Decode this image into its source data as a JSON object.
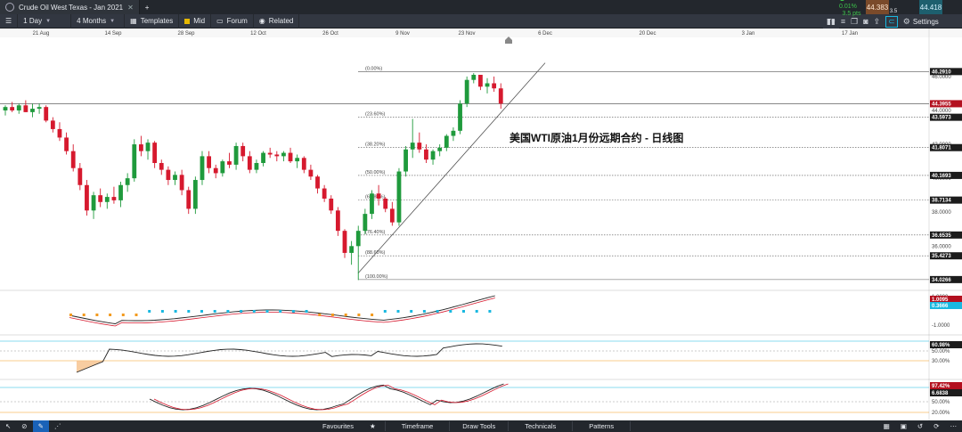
{
  "tab": {
    "title": "Crude Oil West Texas - Jan 2021",
    "close": "✕",
    "add": "+"
  },
  "toolbar": {
    "interval": "1 Day",
    "range": "4 Months",
    "templates": "Templates",
    "mid": "Mid",
    "forum": "Forum",
    "related": "Related",
    "change_pct": "▲ 0.01%",
    "change_pts": "3.5 pts",
    "bid": "44.383",
    "spread": "3.5",
    "ask": "44.418",
    "settings": "Settings"
  },
  "chart_title": "美国WTI原油1月份远期合约 - 日线图",
  "x_ticks": [
    "21 Aug",
    "14 Sep",
    "28 Sep",
    "12 Oct",
    "26 Oct",
    "9 Nov",
    "23 Nov",
    "6 Dec",
    "20 Dec",
    "3 Jan",
    "17 Jan"
  ],
  "price_ticks": [
    "46.0000",
    "44.0000",
    "42.0000",
    "40.0000",
    "38.0000",
    "36.0000",
    "34.0000"
  ],
  "price_tags": [
    {
      "label": "46.2910",
      "style": "dark",
      "v": 46.291
    },
    {
      "label": "44.3955",
      "style": "red",
      "v": 44.3955
    },
    {
      "label": "43.5973",
      "style": "dark",
      "v": 43.5973
    },
    {
      "label": "41.8071",
      "style": "dark",
      "v": 41.8071
    },
    {
      "label": "40.1693",
      "style": "dark",
      "v": 40.1693
    },
    {
      "label": "38.7134",
      "style": "dark",
      "v": 38.7134
    },
    {
      "label": "36.6535",
      "style": "dark",
      "v": 36.6535
    },
    {
      "label": "35.4273",
      "style": "dark",
      "v": 35.4273
    },
    {
      "label": "34.0266",
      "style": "dark",
      "v": 34.0266
    }
  ],
  "fib_levels": [
    {
      "label": "(0.00%)",
      "v": 46.291
    },
    {
      "label": "(23.60%)",
      "v": 43.5973
    },
    {
      "label": "(38.20%)",
      "v": 41.8071
    },
    {
      "label": "(50.00%)",
      "v": 40.1693
    },
    {
      "label": "(61.80%)",
      "v": 38.7134
    },
    {
      "label": "(76.40%)",
      "v": 36.6535
    },
    {
      "label": "(88.60%)",
      "v": 35.4273
    },
    {
      "label": "(100.00%)",
      "v": 34.0266
    }
  ],
  "macd_ticks": [
    "1.0000",
    "-1.0000"
  ],
  "macd_tags": [
    {
      "label": "1.0095",
      "style": "red"
    },
    {
      "label": "0.3666",
      "style": "cyan"
    }
  ],
  "rsi_ticks": [
    "50.00%",
    "30.00%"
  ],
  "rsi_tag": {
    "label": "60.98%",
    "style": "dark"
  },
  "stoch_ticks": [
    "50.00%",
    "20.00%"
  ],
  "stoch_tags": [
    {
      "label": "97.42%",
      "style": "red"
    },
    {
      "label": "6.6838",
      "style": "dark"
    }
  ],
  "footer": {
    "favourites": "Favourites",
    "timeframe": "Timeframe",
    "draw_tools": "Draw Tools",
    "technicals": "Technicals",
    "patterns": "Patterns"
  },
  "colors": {
    "up": "#1f9a3c",
    "down": "#d6192e",
    "accent": "#19b8e0",
    "fib": "#555555"
  },
  "chart_data": {
    "type": "candlestick",
    "ylim": [
      33.6,
      48.2
    ],
    "candles": [
      [
        44.0,
        44.3,
        43.7,
        44.2
      ],
      [
        44.2,
        44.5,
        43.9,
        44.0
      ],
      [
        44.0,
        44.4,
        43.8,
        44.3
      ],
      [
        44.3,
        44.6,
        43.9,
        43.9
      ],
      [
        43.9,
        44.4,
        43.6,
        44.1
      ],
      [
        44.1,
        44.4,
        43.8,
        44.2
      ],
      [
        44.2,
        44.3,
        43.3,
        43.4
      ],
      [
        43.4,
        43.6,
        42.7,
        42.9
      ],
      [
        42.9,
        43.3,
        42.2,
        42.4
      ],
      [
        42.4,
        42.7,
        41.4,
        41.6
      ],
      [
        41.6,
        42.0,
        40.4,
        40.6
      ],
      [
        40.6,
        40.9,
        39.3,
        39.6
      ],
      [
        39.6,
        39.9,
        37.8,
        38.1
      ],
      [
        38.1,
        39.2,
        37.6,
        39.0
      ],
      [
        39.0,
        39.4,
        38.3,
        38.6
      ],
      [
        38.6,
        39.1,
        38.2,
        38.9
      ],
      [
        38.9,
        39.5,
        38.5,
        38.7
      ],
      [
        38.7,
        39.8,
        38.3,
        39.6
      ],
      [
        39.6,
        40.3,
        39.2,
        40.0
      ],
      [
        40.0,
        42.3,
        39.8,
        42.0
      ],
      [
        42.0,
        42.5,
        41.3,
        41.6
      ],
      [
        41.6,
        42.3,
        41.1,
        42.1
      ],
      [
        42.1,
        42.2,
        40.6,
        40.9
      ],
      [
        40.9,
        41.1,
        40.2,
        40.5
      ],
      [
        40.5,
        40.7,
        39.6,
        39.9
      ],
      [
        39.9,
        40.4,
        39.6,
        40.2
      ],
      [
        40.2,
        40.5,
        39.0,
        39.3
      ],
      [
        39.3,
        39.5,
        37.9,
        38.2
      ],
      [
        38.2,
        40.1,
        37.9,
        39.9
      ],
      [
        39.9,
        41.6,
        39.6,
        41.3
      ],
      [
        41.3,
        41.6,
        40.3,
        40.6
      ],
      [
        40.6,
        40.8,
        40.0,
        40.3
      ],
      [
        40.3,
        41.1,
        40.1,
        41.0
      ],
      [
        41.0,
        41.5,
        40.6,
        40.8
      ],
      [
        40.8,
        42.1,
        40.5,
        41.9
      ],
      [
        41.9,
        42.1,
        41.0,
        41.3
      ],
      [
        41.3,
        41.6,
        40.3,
        40.5
      ],
      [
        40.5,
        41.1,
        40.3,
        40.9
      ],
      [
        40.9,
        41.6,
        40.7,
        41.5
      ],
      [
        41.5,
        41.8,
        41.2,
        41.4
      ],
      [
        41.4,
        41.6,
        41.0,
        41.3
      ],
      [
        41.3,
        41.6,
        41.0,
        41.5
      ],
      [
        41.5,
        41.8,
        40.9,
        41.0
      ],
      [
        41.0,
        41.4,
        40.6,
        41.2
      ],
      [
        41.2,
        41.3,
        40.3,
        40.5
      ],
      [
        40.5,
        40.8,
        39.9,
        40.1
      ],
      [
        40.1,
        40.2,
        39.1,
        39.4
      ],
      [
        39.4,
        39.6,
        38.6,
        38.8
      ],
      [
        38.8,
        39.0,
        37.9,
        38.1
      ],
      [
        38.1,
        38.3,
        36.6,
        36.9
      ],
      [
        36.9,
        37.0,
        35.3,
        35.6
      ],
      [
        35.6,
        36.3,
        34.9,
        36.0
      ],
      [
        36.0,
        37.2,
        34.0,
        36.9
      ],
      [
        36.9,
        38.2,
        36.7,
        37.9
      ],
      [
        37.9,
        39.3,
        37.6,
        39.1
      ],
      [
        39.1,
        39.6,
        38.4,
        38.8
      ],
      [
        38.8,
        38.9,
        38.0,
        38.2
      ],
      [
        38.2,
        38.6,
        37.2,
        37.4
      ],
      [
        37.4,
        40.6,
        37.2,
        40.4
      ],
      [
        40.4,
        41.9,
        40.1,
        41.7
      ],
      [
        41.7,
        43.5,
        41.2,
        42.1
      ],
      [
        42.1,
        42.7,
        41.5,
        41.7
      ],
      [
        41.7,
        42.0,
        40.9,
        41.1
      ],
      [
        41.1,
        41.7,
        40.8,
        41.6
      ],
      [
        41.6,
        42.0,
        41.3,
        41.8
      ],
      [
        41.8,
        42.6,
        41.6,
        42.5
      ],
      [
        42.5,
        43.0,
        42.2,
        42.8
      ],
      [
        42.8,
        44.6,
        42.6,
        44.4
      ],
      [
        44.4,
        46.0,
        44.2,
        45.8
      ],
      [
        45.8,
        46.2,
        45.6,
        46.1
      ],
      [
        46.1,
        46.1,
        45.2,
        45.4
      ],
      [
        45.4,
        45.9,
        45.0,
        45.6
      ],
      [
        45.6,
        46.0,
        45.1,
        45.3
      ],
      [
        45.3,
        45.6,
        44.1,
        44.4
      ]
    ]
  }
}
